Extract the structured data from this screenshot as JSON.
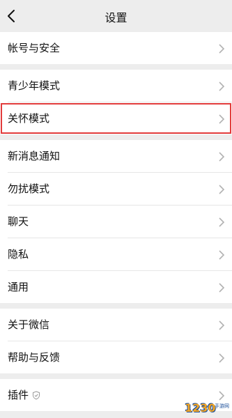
{
  "header": {
    "title": "设置"
  },
  "groups": [
    {
      "items": [
        {
          "label": "帐号与安全"
        }
      ]
    },
    {
      "items": [
        {
          "label": "青少年模式"
        },
        {
          "label": "关怀模式"
        }
      ]
    },
    {
      "items": [
        {
          "label": "新消息通知"
        },
        {
          "label": "勿扰模式"
        },
        {
          "label": "聊天"
        },
        {
          "label": "隐私"
        },
        {
          "label": "通用"
        }
      ]
    },
    {
      "items": [
        {
          "label": "关于微信"
        },
        {
          "label": "帮助与反馈"
        }
      ]
    },
    {
      "items": [
        {
          "label": "插件"
        }
      ]
    }
  ],
  "watermark": {
    "brand": "1230",
    "sub": "手游网"
  }
}
